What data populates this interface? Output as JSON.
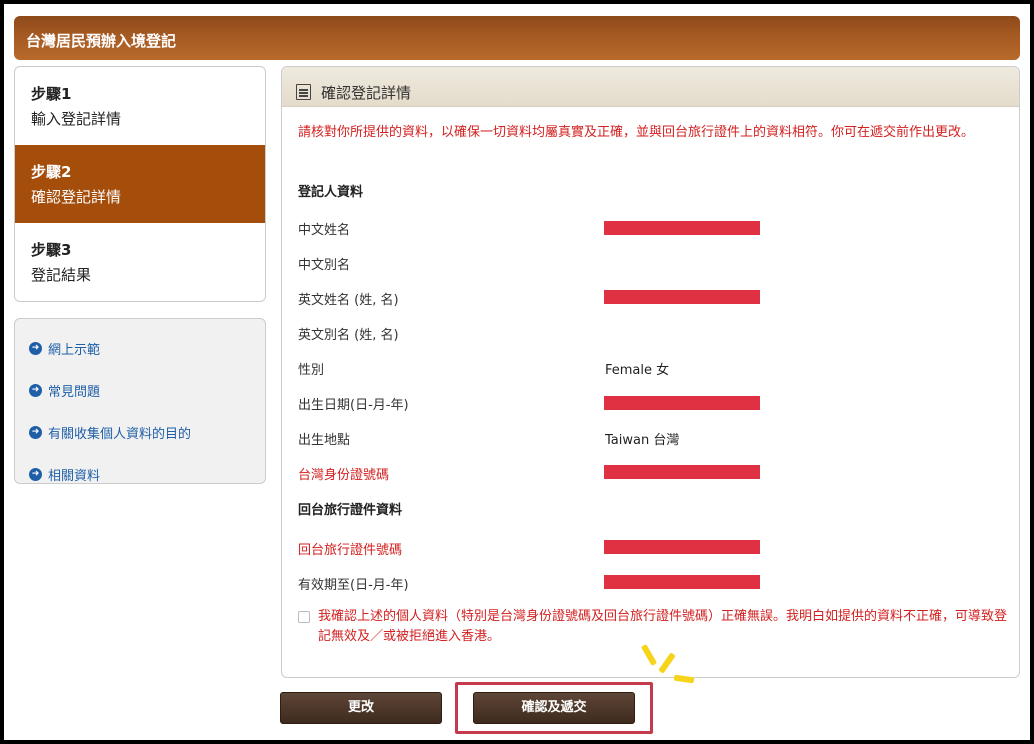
{
  "header": {
    "title": "台灣居民預辦入境登記"
  },
  "steps": [
    {
      "num": "步驟1",
      "label": "輸入登記詳情"
    },
    {
      "num": "步驟2",
      "label": "確認登記詳情"
    },
    {
      "num": "步驟3",
      "label": "登記結果"
    }
  ],
  "links": [
    {
      "label": "網上示範"
    },
    {
      "label": "常見問題"
    },
    {
      "label": "有關收集個人資料的目的"
    },
    {
      "label": "相關資料"
    }
  ],
  "main": {
    "title": "確認登記詳情",
    "notice": "請核對你所提供的資料，以確保一切資料均屬真實及正確，並與回台旅行證件上的資料相符。你可在遞交前作出更改。",
    "section1": "登記人資料",
    "fields": [
      {
        "label": "中文姓名"
      },
      {
        "label": "中文別名"
      },
      {
        "label": "英文姓名 (姓, 名)"
      },
      {
        "label": "英文別名 (姓, 名)"
      },
      {
        "label": "性別",
        "value": "Female 女"
      },
      {
        "label": "出生日期(日-月-年)"
      },
      {
        "label": "出生地點",
        "value": "Taiwan 台灣"
      },
      {
        "label": "台灣身份證號碼"
      }
    ],
    "section2": "回台旅行證件資料",
    "fields2": [
      {
        "label": "回台旅行證件號碼"
      },
      {
        "label": "有效期至(日-月-年)"
      }
    ],
    "confirm_text": "我確認上述的個人資料（特別是台灣身份證號碼及回台旅行證件號碼）正確無誤。我明白如提供的資料不正確，可導致登記無效及／或被拒絕進入香港。"
  },
  "buttons": {
    "modify": "更改",
    "submit": "確認及遞交"
  },
  "colors": {
    "accent": "#a54d0a",
    "required": "#d32020",
    "redaction": "#e03142"
  }
}
